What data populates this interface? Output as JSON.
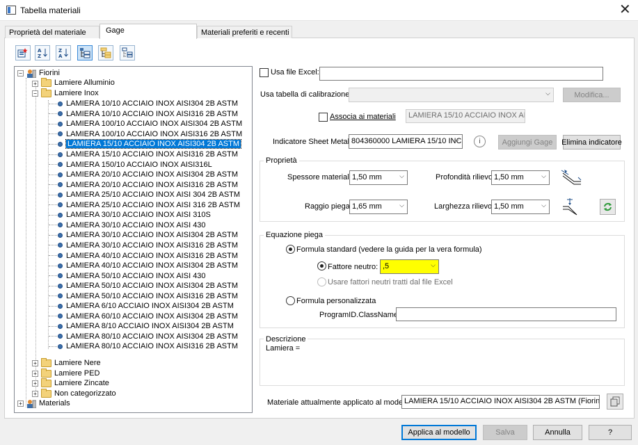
{
  "window": {
    "title": "Tabella materiali",
    "close": "✕"
  },
  "tabs": [
    {
      "label": "Proprietà del materiale"
    },
    {
      "label": "Gage"
    },
    {
      "label": "Materiali preferiti e recenti"
    }
  ],
  "tree": {
    "root": "Fiorini",
    "groups": [
      {
        "label": "Lamiere Alluminio"
      },
      {
        "label": "Lamiere Inox"
      }
    ],
    "items": [
      "LAMIERA 10/10 ACCIAIO INOX AISI304 2B ASTM",
      "LAMIERA 10/10 ACCIAIO INOX AISI316 2B ASTM",
      "LAMIERA 100/10 ACCIAIO INOX AISI304 2B ASTM",
      "LAMIERA 100/10 ACCIAIO INOX AISI316 2B ASTM",
      "LAMIERA 15/10 ACCIAIO INOX AISI304 2B ASTM",
      "LAMIERA 15/10 ACCIAIO INOX AISI316 2B ASTM",
      "LAMIERA 150/10 ACCIAIO INOX AISI316L",
      "LAMIERA 20/10 ACCIAIO INOX AISI304 2B ASTM",
      "LAMIERA 20/10 ACCIAIO INOX AISI316 2B ASTM",
      "LAMIERA 25/10 ACCIAIO INOX AISI 304 2B ASTM",
      "LAMIERA 25/10 ACCIAIO INOX AISI 316 2B ASTM",
      "LAMIERA 30/10 ACCIAIO INOX AISI 310S",
      "LAMIERA 30/10 ACCIAIO INOX AISI 430",
      "LAMIERA 30/10 ACCIAIO INOX AISI304 2B ASTM",
      "LAMIERA 30/10 ACCIAIO INOX AISI316 2B ASTM",
      "LAMIERA 40/10 ACCIAIO INOX AISI316 2B ASTM",
      "LAMIERA 40/10 ACCIAIO INOX AISI304 2B ASTM",
      "LAMIERA 50/10 ACCIAIO INOX AISI 430",
      "LAMIERA 50/10 ACCIAIO INOX AISI304 2B ASTM",
      "LAMIERA 50/10 ACCIAIO INOX AISI316 2B ASTM",
      "LAMIERA 6/10 ACCIAIO INOX AISI304 2B ASTM",
      "LAMIERA 60/10 ACCIAIO INOX AISI304 2B ASTM",
      "LAMIERA 8/10 ACCIAIO INOX AISI304 2B ASTM",
      "LAMIERA 80/10 ACCIAIO INOX AISI304 2B ASTM",
      "LAMIERA 80/10 ACCIAIO INOX AISI316 2B ASTM"
    ],
    "selected": "LAMIERA 15/10 ACCIAIO INOX AISI304 2B ASTM",
    "groups_after": [
      {
        "label": "Lamiere Nere"
      },
      {
        "label": "Lamiere PED"
      },
      {
        "label": "Lamiere Zincate"
      },
      {
        "label": "Non categorizzato"
      }
    ],
    "root2": "Materials"
  },
  "excel": {
    "label": "Usa file Excel:",
    "value": ""
  },
  "calib": {
    "label": "Usa tabella di calibrazione:",
    "value": "",
    "button": "Modifica..."
  },
  "assoc": {
    "label": "Associa ai materiali",
    "value": "LAMIERA 15/10 ACCIAIO INOX AISI3"
  },
  "indicator": {
    "label": "Indicatore Sheet Metal:",
    "value": "804360000 LAMIERA 15/10 INC",
    "add": "Aggiungi Gage",
    "remove": "Elimina indicatore"
  },
  "props": {
    "title": "Proprietà",
    "thickness_label": "Spessore materiale:",
    "thickness": "1,50 mm",
    "depth_label": "Profondità rilievo:",
    "depth": "1,50 mm",
    "radius_label": "Raggio piega:",
    "radius": "1,65 mm",
    "width_label": "Larghezza rilievo:",
    "width": "1,50 mm"
  },
  "bend": {
    "title": "Equazione piega",
    "standard": "Formula standard (vedere la guida per la vera formula)",
    "neutral_label": "Fattore neutro:",
    "neutral": ",5",
    "excel_neutral": "Usare fattori neutri tratti dal file Excel",
    "custom": "Formula personalizzata",
    "classname_label": "ProgramID.ClassName:",
    "classname": ""
  },
  "desc": {
    "title": "Descrizione",
    "text": "Lamiera ="
  },
  "applied": {
    "label": "Materiale attualmente applicato al modello:",
    "value": "LAMIERA 15/10 ACCIAIO INOX AISI304 2B ASTM (Fiorini\\Lami"
  },
  "footer": {
    "apply": "Applica al modello",
    "save": "Salva",
    "cancel": "Annulla",
    "help": "?"
  },
  "colors": {
    "selection": "#0078d7",
    "highlight": "#ffff00",
    "accent": "#0078d7"
  }
}
